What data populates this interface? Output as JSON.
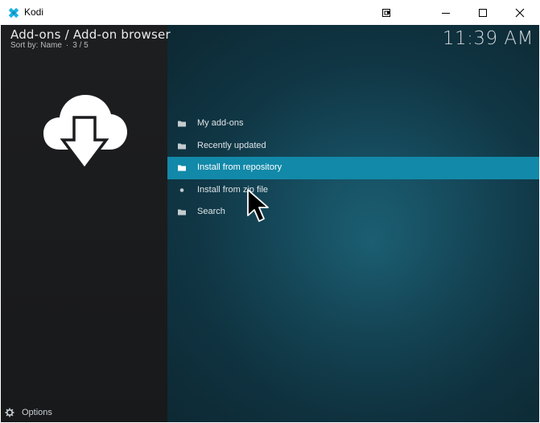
{
  "window": {
    "title": "Kodi",
    "icon": "kodi-logo-icon",
    "controls": [
      "restore-icon",
      "minimize-icon",
      "maximize-icon",
      "close-icon"
    ]
  },
  "header": {
    "breadcrumb": "Add-ons / Add-on browser",
    "sort_label": "Sort by: Name",
    "position": "3 / 5",
    "clock": "11:39 AM"
  },
  "sidebar": {
    "icon": "cloud-download-icon"
  },
  "menu": {
    "items": [
      {
        "label": "My add-ons",
        "icon": "folder-icon"
      },
      {
        "label": "Recently updated",
        "icon": "folder-icon"
      },
      {
        "label": "Install from repository",
        "icon": "folder-icon",
        "selected": true
      },
      {
        "label": "Install from zip file",
        "icon": "bullet-icon"
      },
      {
        "label": "Search",
        "icon": "folder-icon"
      }
    ]
  },
  "footer": {
    "options_label": "Options",
    "options_icon": "options-gear-icon"
  },
  "colors": {
    "accent": "#1289a9",
    "sidebar": "#1b1c1e",
    "background": "#12232c"
  }
}
